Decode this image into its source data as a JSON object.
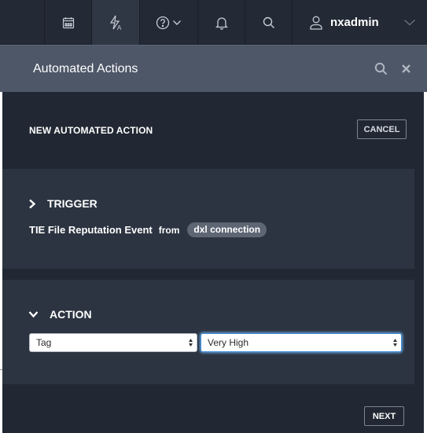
{
  "topbar": {
    "user": {
      "name": "nxadmin"
    },
    "icons": [
      "calendar-icon",
      "automated-actions-icon",
      "help-icon",
      "bell-icon",
      "search-icon",
      "user-icon",
      "chevron-down-icon"
    ]
  },
  "panel": {
    "title": "Automated Actions",
    "header_icons": [
      "search-icon",
      "close-icon"
    ]
  },
  "form": {
    "title": "NEW AUTOMATED ACTION",
    "cancel_label": "CANCEL",
    "trigger": {
      "label": "TRIGGER",
      "event": "TIE File Reputation Event",
      "from_word": "from",
      "connection": "dxl connection"
    },
    "action": {
      "label": "ACTION",
      "type_select": "Tag",
      "value_select": "Very High"
    },
    "next_label": "NEXT"
  },
  "colors": {
    "topbar_bg": "#232a35",
    "header_bg": "#4d5767",
    "body_bg": "#212833",
    "section_bg": "#2c3441",
    "focus": "#3c8fd8"
  }
}
